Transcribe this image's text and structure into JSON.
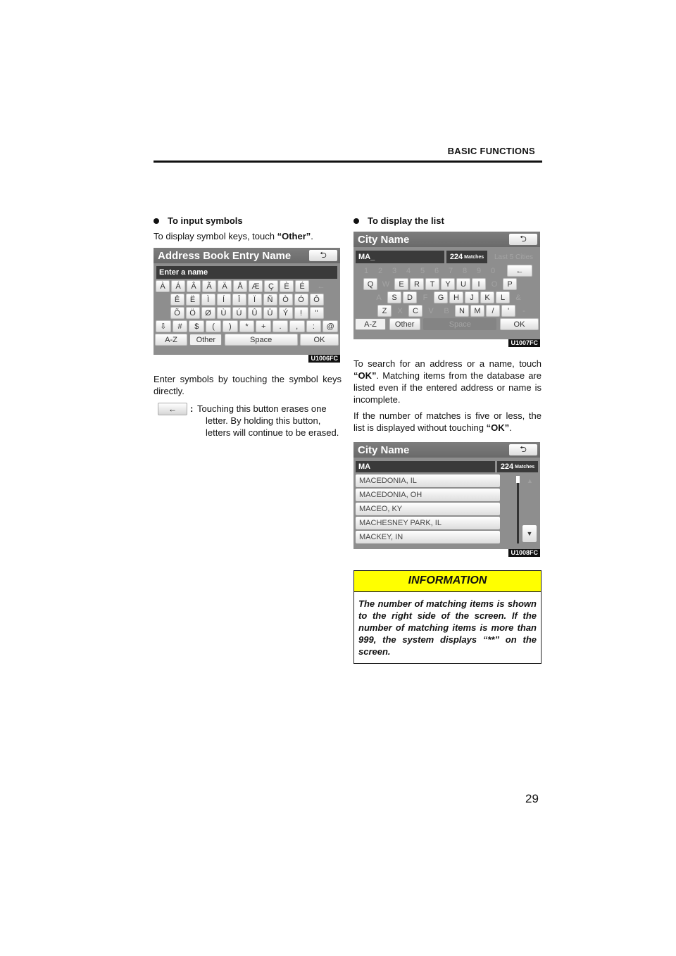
{
  "header": {
    "section_title": "BASIC FUNCTIONS"
  },
  "left": {
    "heading": "To input symbols",
    "intro_prefix": "To display symbol keys, touch ",
    "intro_bold": "“Other”",
    "intro_suffix": ".",
    "screen1": {
      "title": "Address Book Entry Name",
      "back_icon": "⮌",
      "entry_placeholder": "Enter a name",
      "row1": [
        "À",
        "Á",
        "Â",
        "Ã",
        "Ä",
        "Å",
        "Æ",
        "Ç",
        "È",
        "É"
      ],
      "row1_backspace": "←",
      "row2": [
        "Ê",
        "Ë",
        "Ì",
        "Í",
        "Î",
        "Ï",
        "Ñ",
        "Ò",
        "Ó",
        "Ô"
      ],
      "row3": [
        "Õ",
        "Ö",
        "Ø",
        "Ù",
        "Ú",
        "Û",
        "Ü",
        "Ý",
        "!",
        "\""
      ],
      "row4": [
        "⇩",
        "#",
        "$",
        "(",
        ")",
        "*",
        "+",
        ".",
        ",",
        ":",
        "@"
      ],
      "bottom": {
        "az": "A-Z",
        "other": "Other",
        "space": "Space",
        "ok": "OK"
      },
      "caption": "U1006FC"
    },
    "para2": "Enter symbols by touching the symbol keys directly.",
    "erase_icon": "←",
    "erase_colon": ":",
    "erase_desc": "Touching this button erases one letter.  By holding this button, letters will continue to be erased."
  },
  "right": {
    "heading": "To display the list",
    "screen2": {
      "title": "City Name",
      "back_icon": "⮌",
      "input": "MA_",
      "matches_num": "224",
      "matches_label": "Matches",
      "last5": "Last 5 Cities",
      "digits": [
        "1",
        "2",
        "3",
        "4",
        "5",
        "6",
        "7",
        "8",
        "9",
        "0"
      ],
      "backspace": "←",
      "row1": [
        {
          "k": "Q",
          "on": true
        },
        {
          "k": "W",
          "on": false
        },
        {
          "k": "E",
          "on": true
        },
        {
          "k": "R",
          "on": true
        },
        {
          "k": "T",
          "on": true
        },
        {
          "k": "Y",
          "on": true
        },
        {
          "k": "U",
          "on": true
        },
        {
          "k": "I",
          "on": true
        },
        {
          "k": "O",
          "on": false
        },
        {
          "k": "P",
          "on": true
        }
      ],
      "row2": [
        {
          "k": "A",
          "on": false
        },
        {
          "k": "S",
          "on": true
        },
        {
          "k": "D",
          "on": true
        },
        {
          "k": "F",
          "on": false
        },
        {
          "k": "G",
          "on": true
        },
        {
          "k": "H",
          "on": true
        },
        {
          "k": "J",
          "on": true
        },
        {
          "k": "K",
          "on": true
        },
        {
          "k": "L",
          "on": true
        },
        {
          "k": "&",
          "on": false
        }
      ],
      "row3": [
        {
          "k": "Z",
          "on": true
        },
        {
          "k": "X",
          "on": false
        },
        {
          "k": "C",
          "on": true
        },
        {
          "k": "V",
          "on": false
        },
        {
          "k": "B",
          "on": false
        },
        {
          "k": "N",
          "on": true
        },
        {
          "k": "M",
          "on": true
        },
        {
          "k": "/",
          "on": true
        },
        {
          "k": "'",
          "on": true
        },
        {
          "k": "-",
          "on": false
        }
      ],
      "bottom": {
        "az": "A-Z",
        "other": "Other",
        "space": "Space",
        "ok": "OK"
      },
      "caption": "U1007FC"
    },
    "para1_prefix": "To search for an address or a name, touch ",
    "para1_bold": "“OK”",
    "para1_suffix": ".  Matching items from the database are listed even if the entered address or name is incomplete.",
    "para2_prefix": "If the number of matches is five or less, the list is displayed without touching ",
    "para2_bold": "“OK”",
    "para2_suffix": ".",
    "screen3": {
      "title": "City Name",
      "back_icon": "⮌",
      "input": "MA",
      "matches_num": "224",
      "matches_label": "Matches",
      "items": [
        "MACEDONIA, IL",
        "MACEDONIA, OH",
        "MACEO, KY",
        "MACHESNEY PARK, IL",
        "MACKEY, IN"
      ],
      "scroll_up": "▲",
      "scroll_down": "▼",
      "caption": "U1008FC"
    },
    "info": {
      "title": "INFORMATION",
      "body": "The number of matching items is shown to the right side of the screen. If the number of matching items is more than 999, the system displays “**” on the screen."
    }
  },
  "page_number": "29"
}
